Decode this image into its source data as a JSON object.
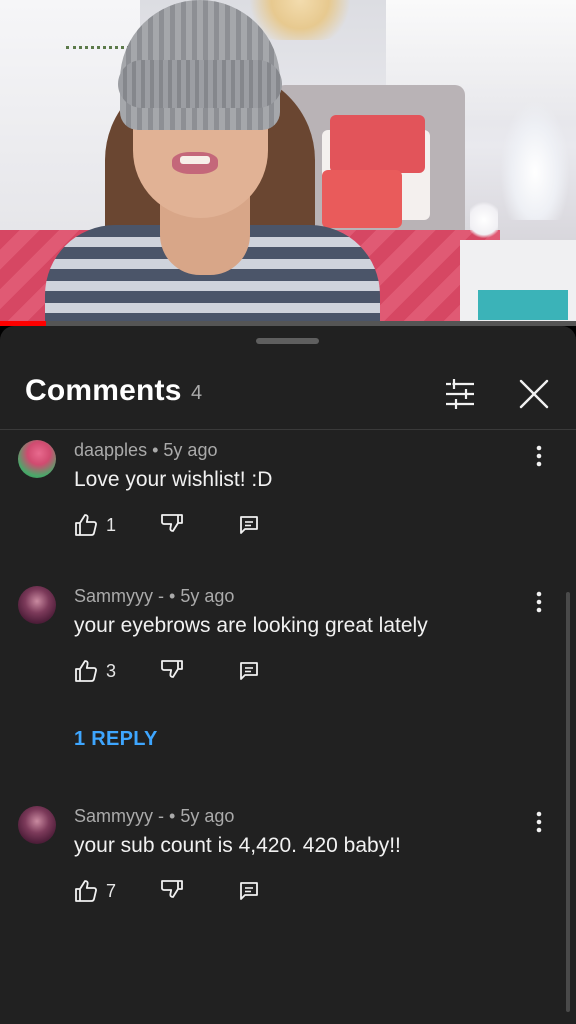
{
  "video": {
    "progress_fraction": 0.08
  },
  "comments_panel": {
    "title": "Comments",
    "count": "4",
    "icons": {
      "filter": "sort-filter-icon",
      "close": "close-icon"
    }
  },
  "comments": [
    {
      "author": "daapples",
      "separator": "•",
      "age": "5y ago",
      "text": "Love your wishlist! :D",
      "likes": "1"
    },
    {
      "author": "Sammyyy -",
      "separator": "•",
      "age": "5y ago",
      "text": "your eyebrows are looking great lately",
      "likes": "3",
      "replies_label": "1 REPLY"
    },
    {
      "author": "Sammyyy -",
      "separator": "•",
      "age": "5y ago",
      "text": "your sub count is 4,420. 420 baby!!",
      "likes": "7"
    }
  ],
  "colors": {
    "sheet_bg": "#212121",
    "link_blue": "#3ea6ff",
    "progress_red": "#ff0000"
  }
}
